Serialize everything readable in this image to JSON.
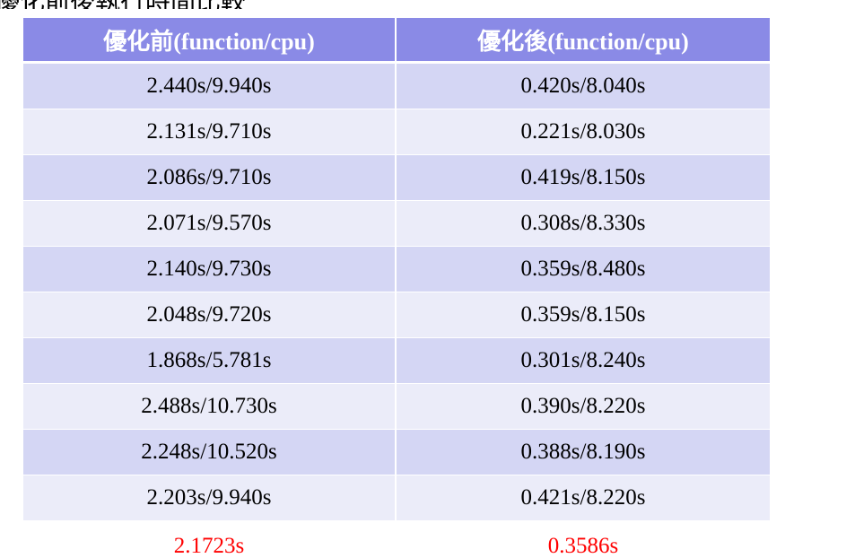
{
  "title_fragment": "優化前後執行時間比較",
  "table": {
    "headers": [
      "優化前(function/cpu)",
      "優化後(function/cpu)"
    ],
    "rows": [
      [
        "2.440s/9.940s",
        "0.420s/8.040s"
      ],
      [
        "2.131s/9.710s",
        "0.221s/8.030s"
      ],
      [
        "2.086s/9.710s",
        "0.419s/8.150s"
      ],
      [
        "2.071s/9.570s",
        "0.308s/8.330s"
      ],
      [
        "2.140s/9.730s",
        "0.359s/8.480s"
      ],
      [
        "2.048s/9.720s",
        "0.359s/8.150s"
      ],
      [
        "1.868s/5.781s",
        "0.301s/8.240s"
      ],
      [
        "2.488s/10.730s",
        "0.390s/8.220s"
      ],
      [
        "2.248s/10.520s",
        "0.388s/8.190s"
      ],
      [
        "2.203s/9.940s",
        "0.421s/8.220s"
      ]
    ],
    "averages": [
      "2.1723s",
      "0.3586s"
    ]
  },
  "colors": {
    "header_bg": "#8a8ae6",
    "row_odd": "#d4d6f4",
    "row_even": "#ebecf9",
    "average_text": "#ff0000"
  }
}
